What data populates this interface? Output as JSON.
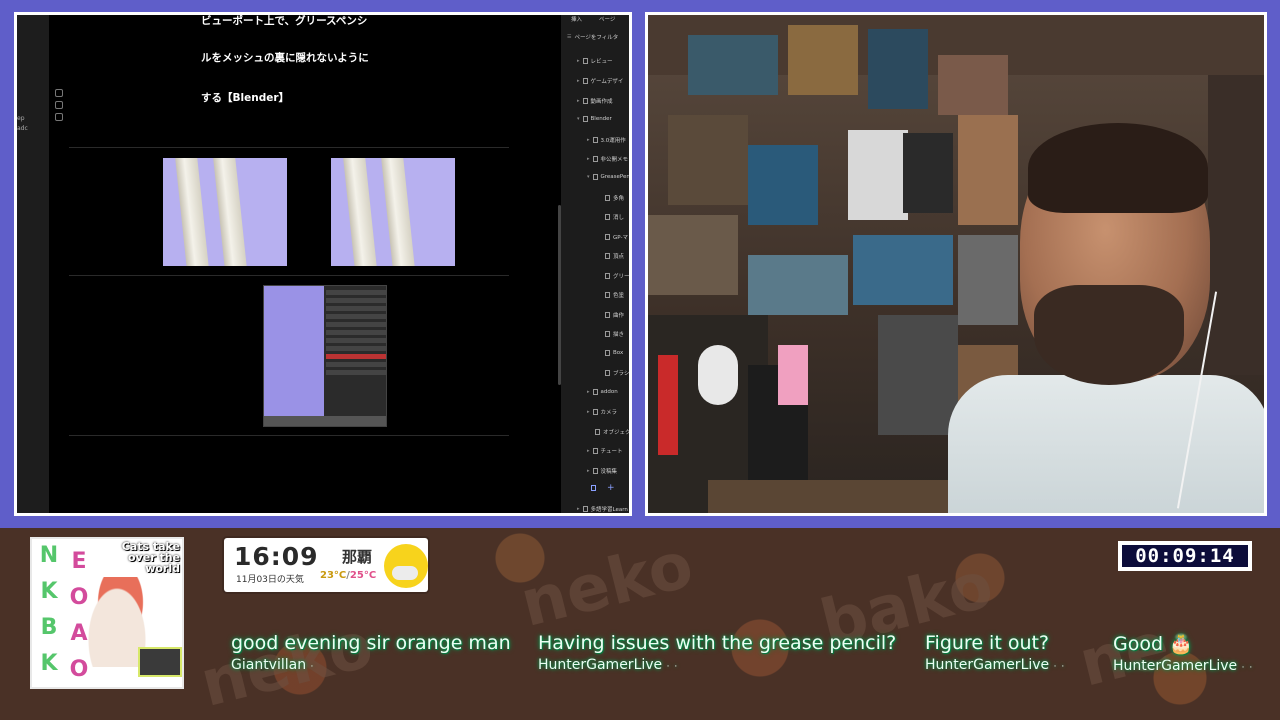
{
  "note_app": {
    "gutter_labels": [
      "ep",
      "adc"
    ],
    "doc_lines": [
      "ビューポート上で、グリースペンシ",
      "ルをメッシュの裏に隠れないように",
      "する【Blender】"
    ],
    "sidebar": {
      "header_items": [
        "挿入",
        "ページ"
      ],
      "filter_label": "ページをフィルタ",
      "items": [
        {
          "label": "レビュー",
          "chevron": "▸"
        },
        {
          "label": "ゲームデザイ",
          "chevron": "▸"
        },
        {
          "label": "動画作成",
          "chevron": "▸"
        },
        {
          "label": "Blender",
          "chevron": "▾"
        },
        {
          "label": "3.0運用作",
          "chevron": "▸"
        },
        {
          "label": "非公開メモ",
          "chevron": "▸"
        },
        {
          "label": "GreasePen",
          "chevron": "▾"
        },
        {
          "label": "多角",
          "chevron": ""
        },
        {
          "label": "消し",
          "chevron": ""
        },
        {
          "label": "GP-マ",
          "chevron": ""
        },
        {
          "label": "頂点",
          "chevron": ""
        },
        {
          "label": "グリー",
          "chevron": ""
        },
        {
          "label": "色塗",
          "chevron": ""
        },
        {
          "label": "曲作",
          "chevron": ""
        },
        {
          "label": "描き",
          "chevron": ""
        },
        {
          "label": "Box",
          "chevron": ""
        },
        {
          "label": "ブラシ",
          "chevron": ""
        },
        {
          "label": "addon",
          "chevron": "▸"
        },
        {
          "label": "カメラ",
          "chevron": "▸"
        },
        {
          "label": "オブジェク",
          "chevron": ""
        },
        {
          "label": "チュート",
          "chevron": "▸"
        },
        {
          "label": "没稿集",
          "chevron": "▸"
        },
        {
          "label": "多語学習Learn",
          "chevron": "▸"
        }
      ],
      "add_icon": "+"
    }
  },
  "overlay": {
    "logo": {
      "letters": [
        "N",
        "E",
        "K",
        "O",
        "B",
        "A",
        "K",
        "O"
      ],
      "tagline": "Cats take over the world"
    },
    "clock": {
      "time": "16:09",
      "date": "11月03日の天気",
      "city": "那覇",
      "temp_high": "23°C",
      "temp_sep": "/",
      "temp_low": "25°C",
      "weather_icon": "sun-cloud-icon"
    },
    "timer": "00:09:14",
    "chat": [
      {
        "text": "good evening sir orange man",
        "user": "Giantvillan"
      },
      {
        "text": "Having issues with the grease pencil?",
        "user": "HunterGamerLive"
      },
      {
        "text": "Figure it out?",
        "user": "HunterGamerLive"
      },
      {
        "text": "Good 🎂",
        "user": "HunterGamerLive"
      }
    ],
    "colors": {
      "frame_bg": "#5f5ec9",
      "bar_bg": "#4a3126",
      "chat_glow": "#0b8d4b",
      "timer_bg": "#0c0c3a",
      "sun": "#f7d31c"
    }
  }
}
